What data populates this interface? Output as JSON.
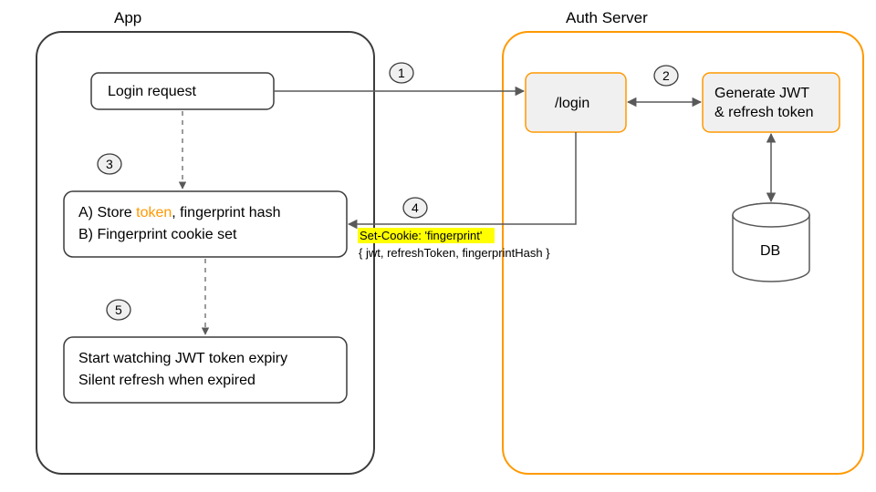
{
  "containers": {
    "app_title": "App",
    "auth_title": "Auth Server"
  },
  "nodes": {
    "login_request": "Login request",
    "login_endpoint": "/login",
    "generate_line1": "Generate JWT",
    "generate_line2": "& refresh token",
    "db": "DB",
    "store_line1_a": "A) Store ",
    "store_line1_token": "token",
    "store_line1_b": ", fingerprint hash",
    "store_line2": "B) Fingerprint cookie set",
    "watch_line1": "Start watching JWT token expiry",
    "watch_line2": "Silent refresh when expired"
  },
  "steps": {
    "s1": "1",
    "s2": "2",
    "s3": "3",
    "s4": "4",
    "s5": "5"
  },
  "annotations": {
    "set_cookie": "Set-Cookie: 'fingerprint'",
    "payload": "{ jwt, refreshToken, fingerprintHash }"
  },
  "colors": {
    "container_app": "#3c3c3c",
    "container_auth": "#ff9900",
    "node_stroke": "#3c3c3c",
    "node_fill_light": "#ffffff",
    "node_fill_grey": "#f0f0f0",
    "node_stroke_orange": "#ff9900",
    "arrow": "#595959",
    "highlight": "#ffff00",
    "token_text": "#ff9900"
  }
}
